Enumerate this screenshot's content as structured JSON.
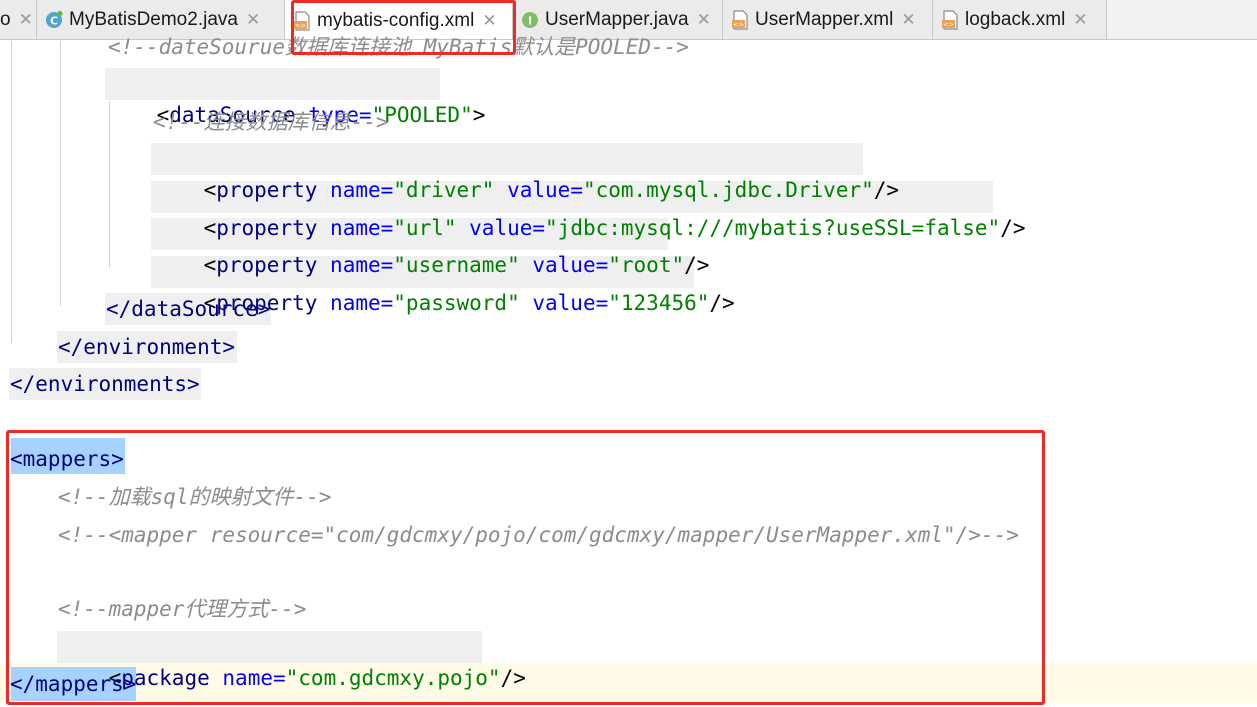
{
  "tabs": [
    {
      "label": "o",
      "icon": "",
      "active": false
    },
    {
      "label": "MyBatisDemo2.java",
      "icon": "java-class-icon",
      "active": false
    },
    {
      "label": "mybatis-config.xml",
      "icon": "xml-file-icon",
      "active": true
    },
    {
      "label": "UserMapper.java",
      "icon": "java-interface-icon",
      "active": false
    },
    {
      "label": "UserMapper.xml",
      "icon": "xml-file-icon",
      "active": false
    },
    {
      "label": "logback.xml",
      "icon": "xml-file-icon",
      "active": false
    }
  ],
  "close_glyph": "✕",
  "highlight_color": "#ee2a24",
  "code": {
    "l0": "<!--dateSourue数据库连接池 MyBatis默认是POOLED-->",
    "l1": {
      "open": "<",
      "tag": "dataSource",
      "attr": "type",
      "eq": "=",
      "val": "\"POOLED\"",
      "close": ">"
    },
    "l2": "<!--连接数据库信息-->",
    "props": [
      {
        "name": "\"driver\"",
        "value": "\"com.mysql.jdbc.Driver\""
      },
      {
        "name": "\"url\"",
        "value": "\"jdbc:mysql:///mybatis?useSSL=false\""
      },
      {
        "name": "\"username\"",
        "value": "\"root\""
      },
      {
        "name": "\"password\"",
        "value": "\"123456\""
      }
    ],
    "prop_tag": "property",
    "name_attr": "name",
    "value_attr": "value",
    "self_close": "/>",
    "l7": "</dataSource>",
    "l8": "</environment>",
    "l9": "</environments>",
    "mappers_open": "<mappers>",
    "c1": "<!--加载sql的映射文件-->",
    "c2": "<!--<mapper resource=\"com/gdcmxy/pojo/com/gdcmxy/mapper/UserMapper.xml\"/>-->",
    "c3": "<!--mapper代理方式-->",
    "pkg": {
      "tag": "package",
      "attr": "name",
      "val": "\"com.gdcmxy.pojo\""
    },
    "mappers_close": "</mappers>"
  }
}
